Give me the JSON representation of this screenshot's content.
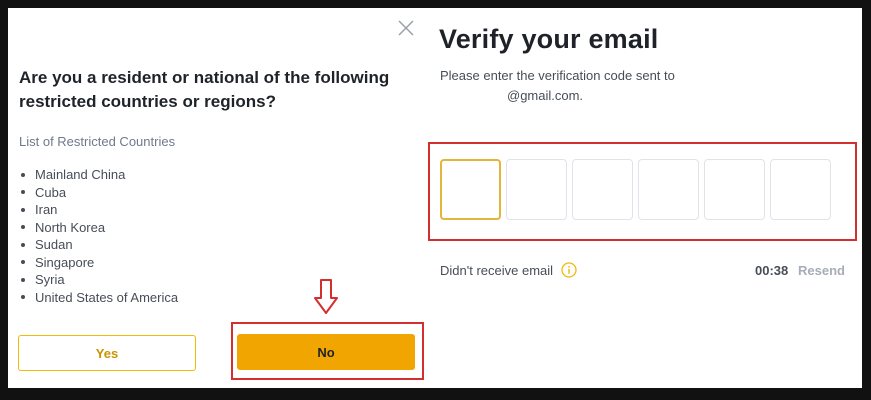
{
  "restriction_dialog": {
    "question": "Are you a resident or national of the following restricted countries or regions?",
    "list_title": "List of Restricted Countries",
    "countries": [
      "Mainland China",
      "Cuba",
      "Iran",
      "North Korea",
      "Sudan",
      "Singapore",
      "Syria",
      "United States of America"
    ],
    "yes_label": "Yes",
    "no_label": "No"
  },
  "verify_panel": {
    "title": "Verify your email",
    "instruction": "Please enter the verification code sent to",
    "email": "@gmail.com.",
    "code_digits": [
      "",
      "",
      "",
      "",
      "",
      ""
    ],
    "didnt_receive": "Didn't receive email",
    "timer": "00:38",
    "resend_label": "Resend"
  },
  "colors": {
    "accent": "#f0a500",
    "accent_border": "#f0b90b",
    "highlight": "#d32f2f"
  },
  "icons": {
    "close": "close-icon",
    "arrow": "arrow-down-icon",
    "info": "info-icon"
  }
}
